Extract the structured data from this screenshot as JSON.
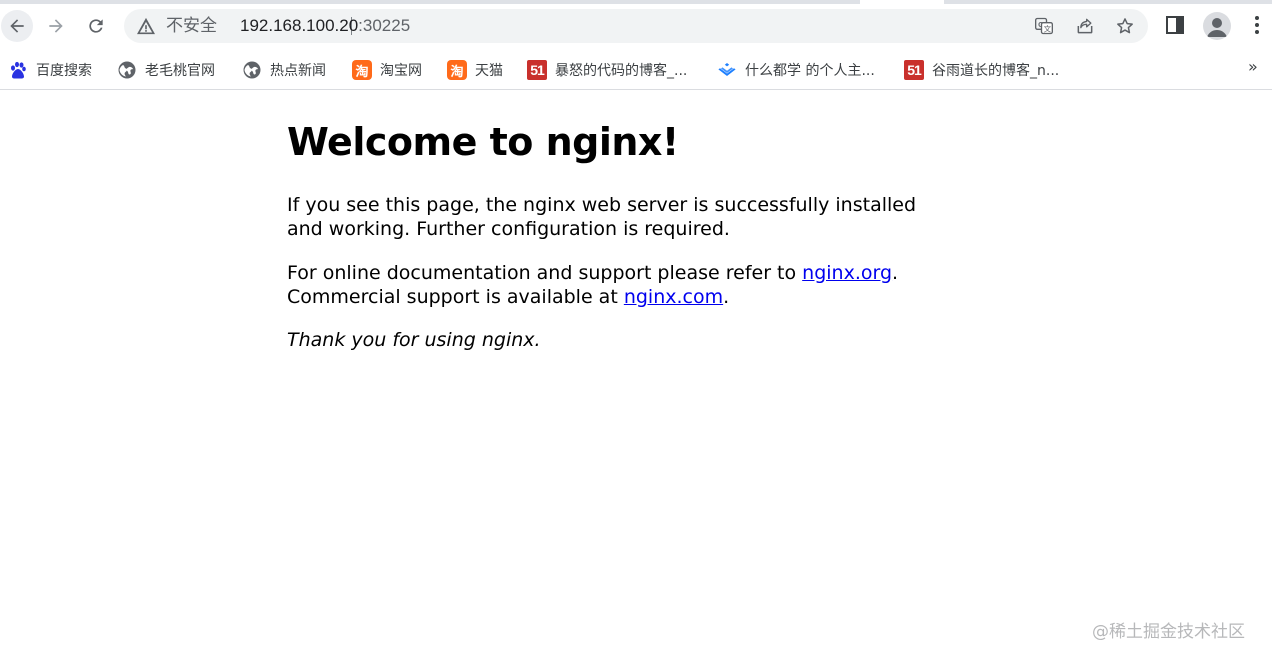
{
  "browser": {
    "address_bar": {
      "security_label": "不安全",
      "url_host": "192.168.100.20",
      "url_port": ":30225"
    },
    "bookmarks": [
      {
        "label": "百度搜索",
        "icon": "baidu-paw-icon"
      },
      {
        "label": "老毛桃官网",
        "icon": "globe-icon"
      },
      {
        "label": "热点新闻",
        "icon": "globe-icon"
      },
      {
        "label": "淘宝网",
        "icon": "taobao-icon",
        "badge": "淘"
      },
      {
        "label": "天猫",
        "icon": "taobao-icon",
        "badge": "淘"
      },
      {
        "label": "暴怒的代码的博客_...",
        "icon": "cto51-icon",
        "badge": "51"
      },
      {
        "label": "什么都学 的个人主...",
        "icon": "juejin-icon"
      },
      {
        "label": "谷雨道长的博客_n...",
        "icon": "cto51-icon",
        "badge": "51"
      }
    ],
    "more_bookmarks": "»"
  },
  "page": {
    "heading": "Welcome to nginx!",
    "para1": "If you see this page, the nginx web server is successfully installed and working. Further configuration is required.",
    "para2_prefix": "For online documentation and support please refer to ",
    "link_org": "nginx.org",
    "para2_mid": ".",
    "para2_line2": "Commercial support is available at ",
    "link_com": "nginx.com",
    "para2_end": ".",
    "para3": "Thank you for using nginx."
  },
  "watermark": "@稀土掘金技术社区",
  "colors": {
    "link": "#0000ee",
    "omnibox_bg": "#f1f3f4",
    "badge_51": "#c9302c",
    "badge_tao": "#ff6a1a"
  }
}
